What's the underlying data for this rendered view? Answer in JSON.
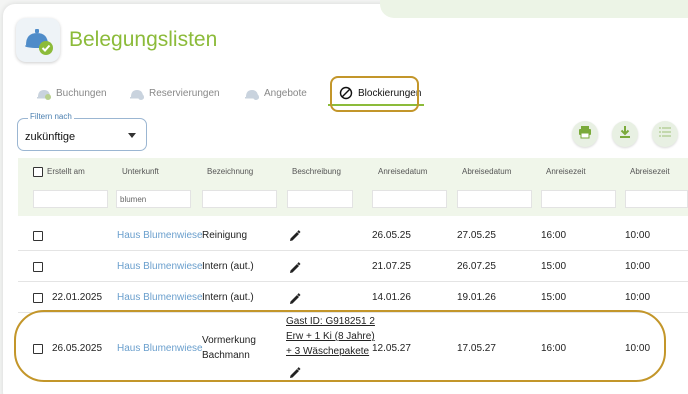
{
  "header": {
    "title": "Belegungslisten"
  },
  "tabs": [
    {
      "label": "Buchungen",
      "icon": "bell-icon"
    },
    {
      "label": "Reservierungen",
      "icon": "bell-icon"
    },
    {
      "label": "Angebote",
      "icon": "bell-icon"
    },
    {
      "label": "Blockierungen",
      "icon": "block-icon",
      "active": true
    }
  ],
  "filter": {
    "label": "Filtern nach",
    "value": "zukünftige"
  },
  "actions": [
    "print-icon",
    "download-icon",
    "list-icon"
  ],
  "table": {
    "columns": [
      "Erstellt am",
      "Unterkunft",
      "Bezeichnung",
      "Beschreibung",
      "Anreisedatum",
      "Abreisedatum",
      "Anreisezeit",
      "Abreisezeit"
    ],
    "filter_values": {
      "unterkunft": "blumen"
    },
    "rows": [
      {
        "erstellt": "",
        "unterkunft": "Haus Blumenwiese",
        "bezeichnung": "Reinigung",
        "anreise": "26.05.25",
        "abreise": "27.05.25",
        "anreisezeit": "16:00",
        "abreisezeit": "10:00"
      },
      {
        "erstellt": "",
        "unterkunft": "Haus Blumenwiese",
        "bezeichnung": "Intern (aut.)",
        "anreise": "21.07.25",
        "abreise": "26.07.25",
        "anreisezeit": "15:00",
        "abreisezeit": "10:00"
      },
      {
        "erstellt": "22.01.2025",
        "unterkunft": "Haus Blumenwiese",
        "bezeichnung": "Intern (aut.)",
        "anreise": "14.01.26",
        "abreise": "19.01.26",
        "anreisezeit": "15:00",
        "abreisezeit": "10:00"
      },
      {
        "erstellt": "26.05.2025",
        "unterkunft": "Haus Blumenwiese",
        "bezeichnung_1": "Vormerkung",
        "bezeichnung_2": "Bachmann",
        "beschreibung_1": "Gast ID: G918251 2",
        "beschreibung_2": "Erw + 1 Ki (8 Jahre)",
        "beschreibung_3": "+ 3 Wäschepakete",
        "anreise": "12.05.27",
        "abreise": "17.05.27",
        "anreisezeit": "16:00",
        "abreisezeit": "10:00"
      }
    ]
  },
  "colors": {
    "brand_green": "#8cbb3a",
    "link_blue": "#6a9fcd",
    "highlight": "#c3962a"
  }
}
